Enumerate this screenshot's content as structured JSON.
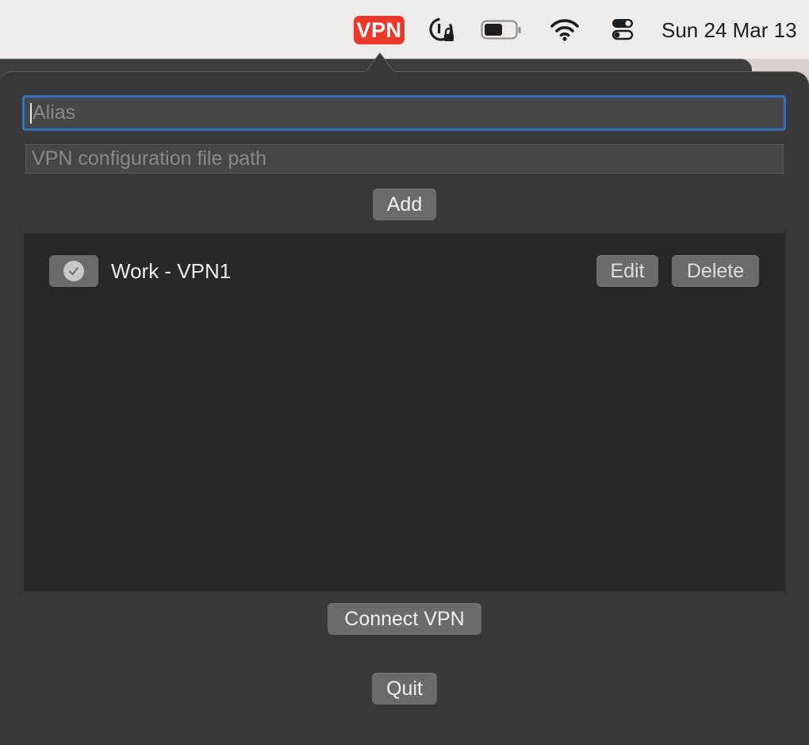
{
  "menubar": {
    "vpn_label": "VPN",
    "clock": "Sun 24 Mar  13",
    "icons": [
      "vpn-icon",
      "password-lock-icon",
      "battery-icon",
      "wifi-icon",
      "control-center-icon"
    ]
  },
  "form": {
    "alias_placeholder": "Alias",
    "path_placeholder": "VPN configuration file path",
    "add_label": "Add"
  },
  "vpn_list": [
    {
      "alias": "Work - VPN1",
      "selected": true,
      "edit_label": "Edit",
      "delete_label": "Delete"
    }
  ],
  "actions": {
    "connect_label": "Connect VPN",
    "quit_label": "Quit"
  },
  "colors": {
    "vpn_badge": "#e8392a",
    "focus_ring": "#3f6fb3",
    "panel_bg": "#383838",
    "list_bg": "#282828",
    "button_bg": "#6b6b6b"
  }
}
